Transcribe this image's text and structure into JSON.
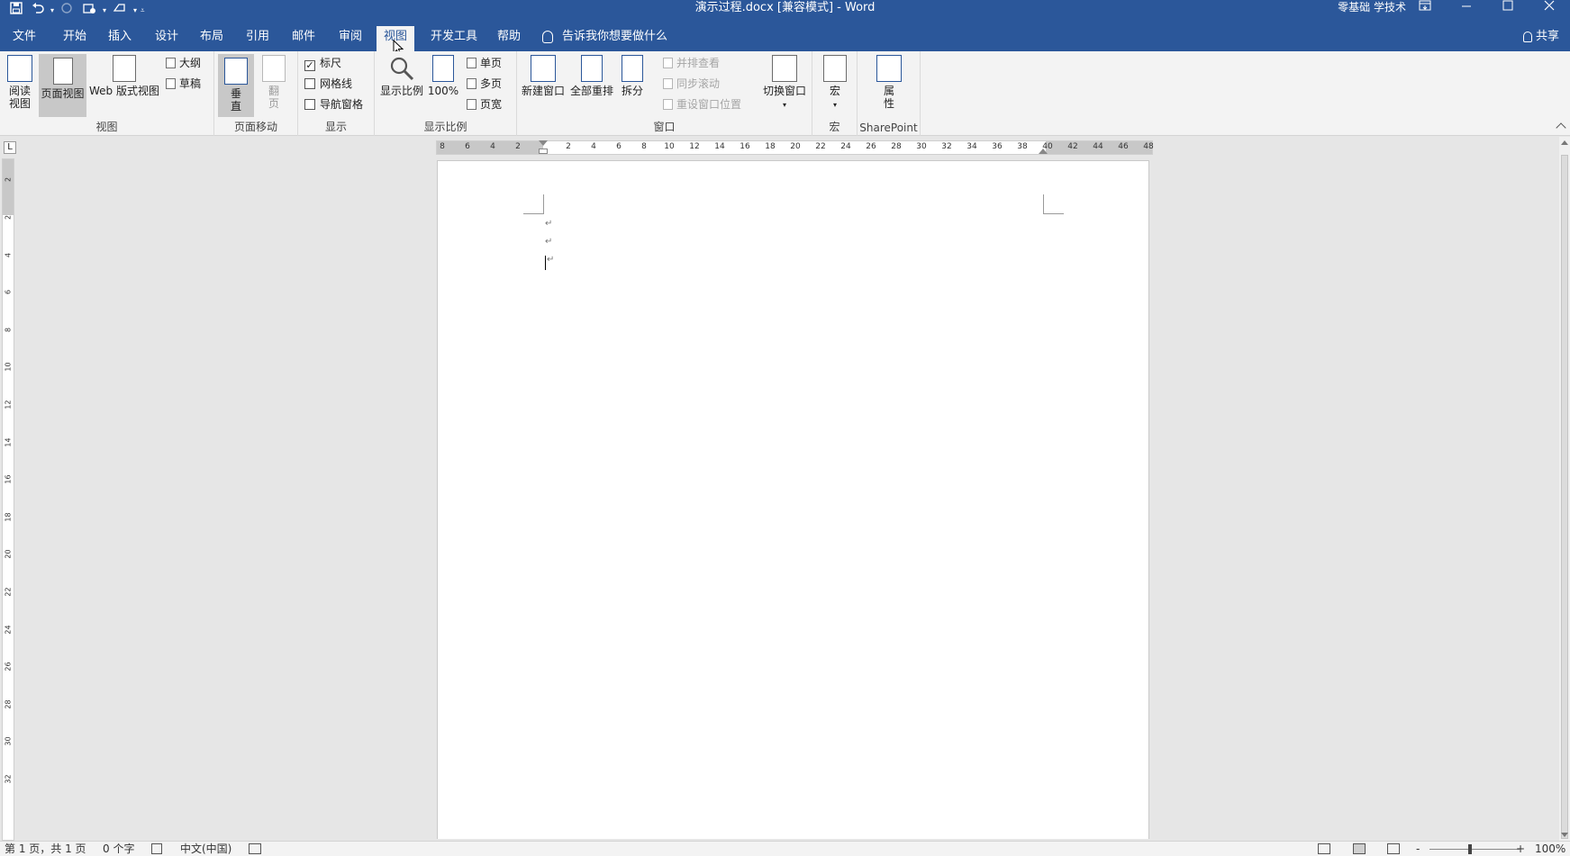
{
  "title_bar": {
    "doc_title": "演示过程.docx [兼容模式]  -  Word",
    "user": "零基础 学技术"
  },
  "tabs": [
    "文件",
    "开始",
    "插入",
    "设计",
    "布局",
    "引用",
    "邮件",
    "审阅",
    "视图",
    "开发工具",
    "帮助"
  ],
  "active_tab": "视图",
  "tell_me": "告诉我你想要做什么",
  "share": "共享",
  "ribbon": {
    "views": {
      "label": "视图",
      "read_mode": "阅读\n视图",
      "read_mode_l1": "阅读",
      "read_mode_l2": "视图",
      "print_layout": "页面视图",
      "web_layout": "Web 版式视图",
      "outline": "大纲",
      "draft": "草稿"
    },
    "page_move": {
      "label": "页面移动",
      "vertical_l1": "垂",
      "vertical_l2": "直",
      "side_l1": "翻",
      "side_l2": "页"
    },
    "show": {
      "label": "显示",
      "ruler": "标尺",
      "ruler_checked": "✓",
      "gridlines": "网格线",
      "nav_pane": "导航窗格"
    },
    "zoom": {
      "label": "显示比例",
      "zoom": "显示比例",
      "hundred": "100%",
      "one_page": "单页",
      "multi_page": "多页",
      "page_width": "页宽"
    },
    "window": {
      "label": "窗口",
      "new_window": "新建窗口",
      "arrange_all": "全部重排",
      "split": "拆分",
      "side_by_side": "并排查看",
      "sync_scroll": "同步滚动",
      "reset_pos": "重设窗口位置",
      "switch_windows": "切换窗口"
    },
    "macros": {
      "label": "宏",
      "macros": "宏"
    },
    "sharepoint": {
      "label": "SharePoint",
      "properties_l1": "属",
      "properties_l2": "性"
    }
  },
  "ruler": {
    "h_ticks": [
      "8",
      "6",
      "4",
      "2",
      "2",
      "4",
      "6",
      "8",
      "10",
      "12",
      "14",
      "16",
      "18",
      "20",
      "22",
      "24",
      "26",
      "28",
      "30",
      "32",
      "34",
      "36",
      "38",
      "40",
      "42",
      "44",
      "46",
      "48"
    ],
    "v_ticks": [
      "2",
      "2",
      "4",
      "6",
      "8",
      "10",
      "12",
      "14",
      "16",
      "18",
      "20",
      "22",
      "24",
      "26",
      "28",
      "30",
      "32"
    ],
    "corner": "L"
  },
  "document": {
    "para_mark": "↵"
  },
  "status_bar": {
    "page": "第 1 页，共 1 页",
    "words": "0 个字",
    "language": "中文(中国)",
    "zoom_minus": "-",
    "zoom_plus": "+",
    "zoom_level": "100%"
  },
  "colors": {
    "brand": "#2b579a",
    "ribbon_bg": "#f3f3f3"
  }
}
